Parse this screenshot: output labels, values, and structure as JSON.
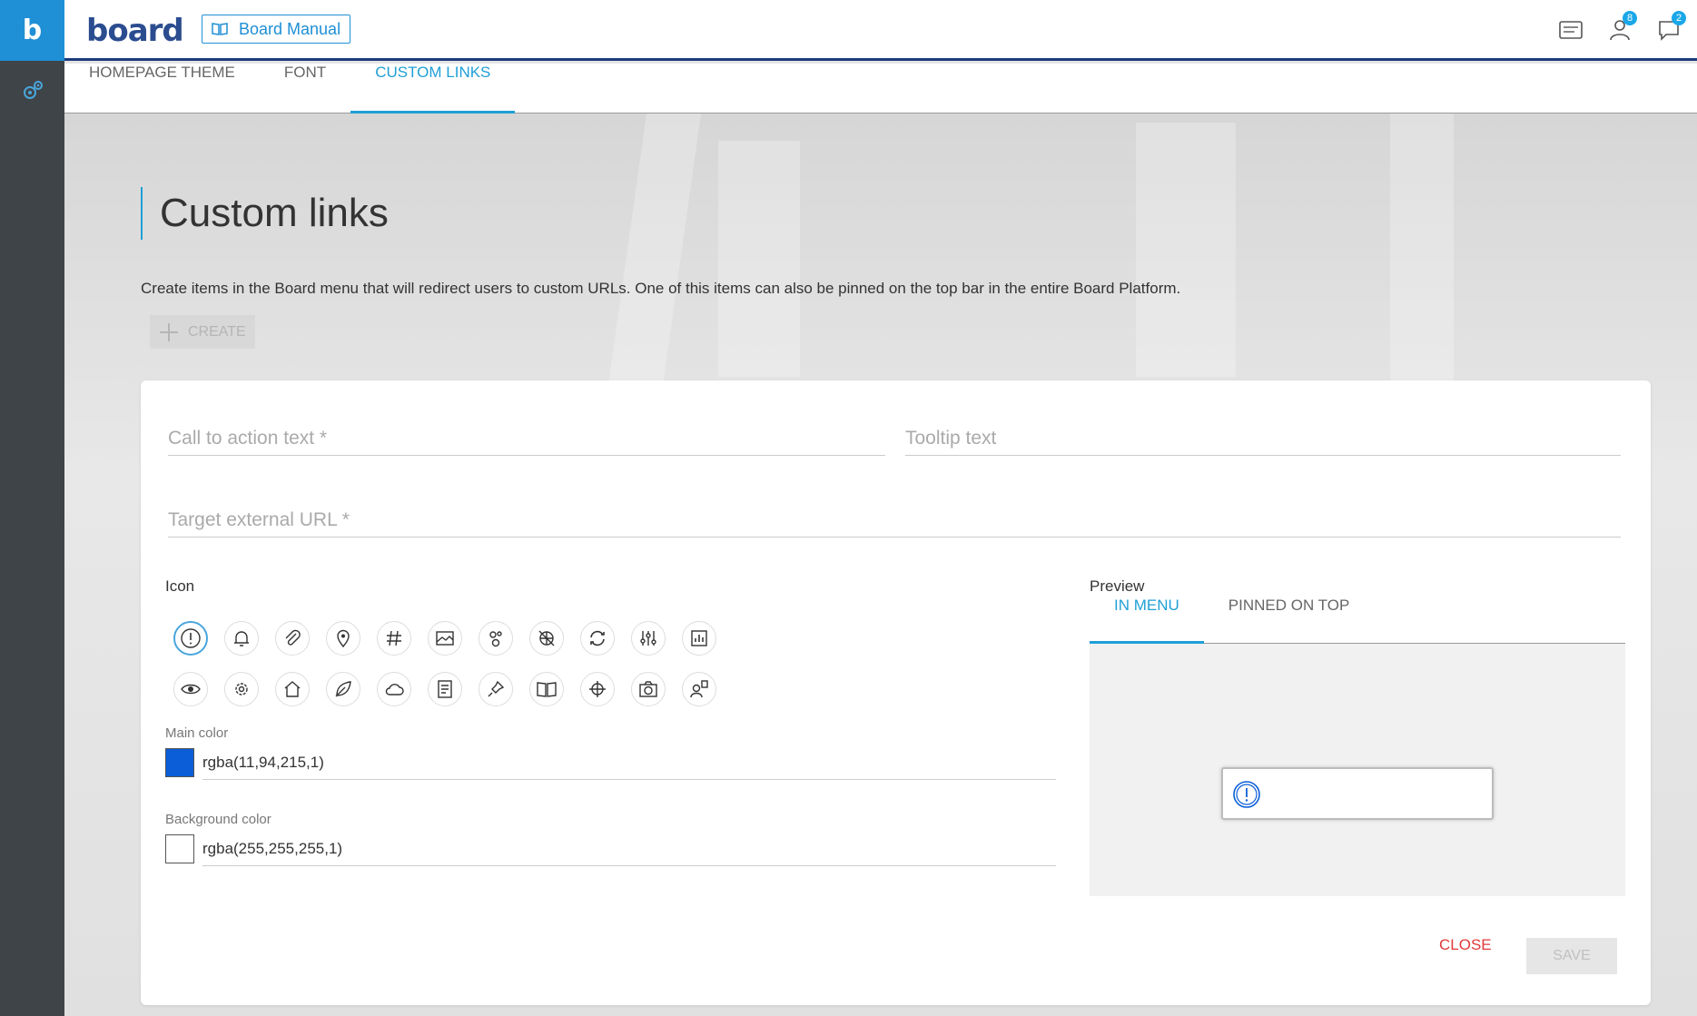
{
  "sidebar": {
    "logo_letter": "b",
    "items": [
      {
        "icon": "settings-gears-icon"
      }
    ]
  },
  "topbar": {
    "brand": "board",
    "manual_label": "Board Manual",
    "icons": [
      {
        "name": "messages-icon",
        "badge": ""
      },
      {
        "name": "users-icon",
        "badge": "8"
      },
      {
        "name": "chat-icon",
        "badge": "2"
      }
    ]
  },
  "tabs": [
    {
      "label": "HOMEPAGE THEME",
      "active": false
    },
    {
      "label": "FONT",
      "active": false
    },
    {
      "label": "CUSTOM LINKS",
      "active": true
    }
  ],
  "page": {
    "title": "Custom links",
    "description": "Create items in the Board menu that will redirect users to custom URLs. One of this items can also be pinned on the top bar in the entire Board Platform.",
    "create_label": "CREATE"
  },
  "form": {
    "cta_placeholder": "Call to action text *",
    "tooltip_placeholder": "Tooltip text",
    "url_placeholder": "Target external URL *",
    "icon_label": "Icon",
    "icons": [
      "exclamation-icon",
      "bell-icon",
      "paperclip-icon",
      "map-pin-icon",
      "hashtag-icon",
      "image-icon",
      "molecule-icon",
      "globe-crossed-icon",
      "refresh-icon",
      "sliders-icon",
      "chart-board-icon",
      "eye-icon",
      "gear-icon",
      "home-icon",
      "leaf-icon",
      "cloud-icon",
      "document-icon",
      "pin-icon",
      "book-icon",
      "crosshair-icon",
      "camera-icon",
      "user-badge-icon"
    ],
    "selected_icon": "exclamation-icon",
    "main_color_label": "Main color",
    "main_color_value": "rgba(11,94,215,1)",
    "main_color_hex": "#0b5ed7",
    "background_color_label": "Background color",
    "background_color_value": "rgba(255,255,255,1)",
    "background_color_hex": "#ffffff"
  },
  "preview": {
    "label": "Preview",
    "tabs": [
      {
        "label": "IN MENU",
        "active": true
      },
      {
        "label": "PINNED ON TOP",
        "active": false
      }
    ]
  },
  "actions": {
    "close_label": "CLOSE",
    "save_label": "SAVE"
  },
  "colors": {
    "accent": "#1f9fd6",
    "sidebar": "#3f4448",
    "danger": "#e03a3a"
  }
}
